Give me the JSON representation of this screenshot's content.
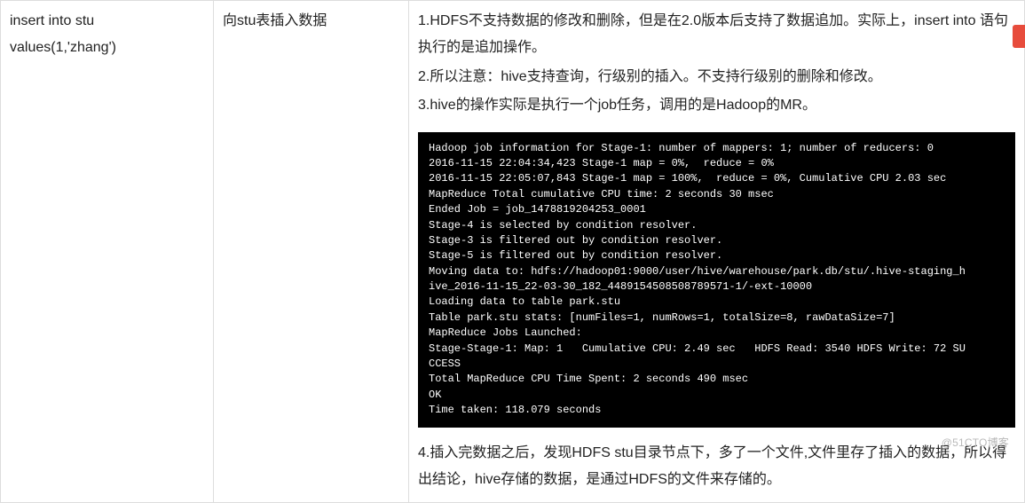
{
  "row": {
    "sql": "insert into stu\nvalues(1,'zhang')",
    "desc": "向stu表插入数据",
    "points": [
      "1.HDFS不支持数据的修改和删除，但是在2.0版本后支持了数据追加。实际上，insert into 语句执行的是追加操作。",
      "2.所以注意：hive支持查询，行级别的插入。不支持行级别的删除和修改。",
      "3.hive的操作实际是执行一个job任务，调用的是Hadoop的MR。"
    ],
    "console": "Hadoop job information for Stage-1: number of mappers: 1; number of reducers: 0\n2016-11-15 22:04:34,423 Stage-1 map = 0%,  reduce = 0%\n2016-11-15 22:05:07,843 Stage-1 map = 100%,  reduce = 0%, Cumulative CPU 2.03 sec\nMapReduce Total cumulative CPU time: 2 seconds 30 msec\nEnded Job = job_1478819204253_0001\nStage-4 is selected by condition resolver.\nStage-3 is filtered out by condition resolver.\nStage-5 is filtered out by condition resolver.\nMoving data to: hdfs://hadoop01:9000/user/hive/warehouse/park.db/stu/.hive-staging_h\nive_2016-11-15_22-03-30_182_4489154508508789571-1/-ext-10000\nLoading data to table park.stu\nTable park.stu stats: [numFiles=1, numRows=1, totalSize=8, rawDataSize=7]\nMapReduce Jobs Launched:\nStage-Stage-1: Map: 1   Cumulative CPU: 2.49 sec   HDFS Read: 3540 HDFS Write: 72 SU\nCCESS\nTotal MapReduce CPU Time Spent: 2 seconds 490 msec\nOK\nTime taken: 118.079 seconds",
    "after": "4.插入完数据之后，发现HDFS stu目录节点下，多了一个文件,文件里存了插入的数据，所以得出结论，hive存储的数据，是通过HDFS的文件来存储的。"
  },
  "watermark": "@51CTO博客"
}
